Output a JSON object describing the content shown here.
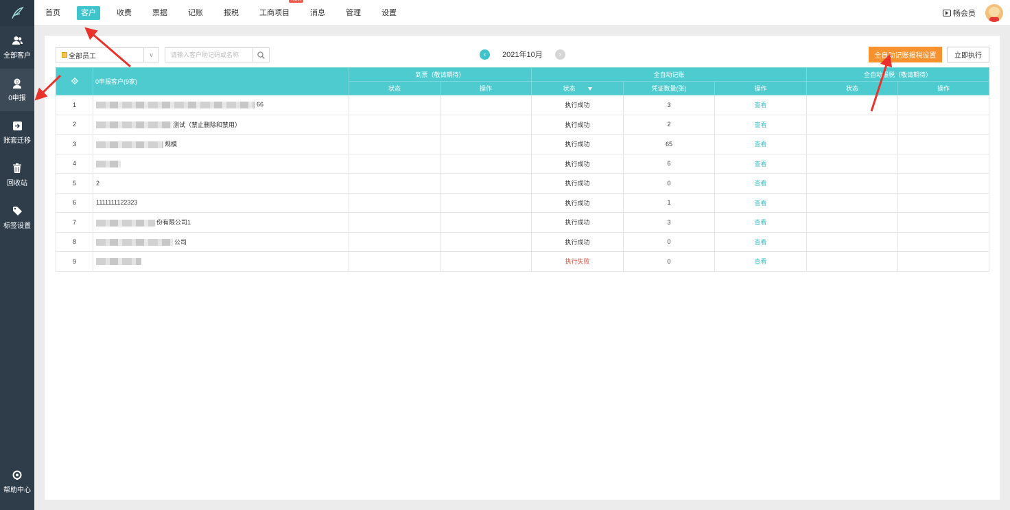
{
  "sidebar": {
    "items": [
      {
        "label": "全部客户",
        "icon": "users-icon"
      },
      {
        "label": "0申报",
        "icon": "zero-report-icon"
      },
      {
        "label": "账套迁移",
        "icon": "migrate-icon"
      },
      {
        "label": "回收站",
        "icon": "trash-icon"
      },
      {
        "label": "标签设置",
        "icon": "tag-icon"
      }
    ],
    "help": "帮助中心"
  },
  "nav": {
    "items": [
      "首页",
      "客户",
      "收费",
      "票据",
      "记账",
      "报税",
      "工商项目",
      "消息",
      "管理",
      "设置"
    ],
    "active": "客户",
    "new_badge": "new",
    "member": "畅会员"
  },
  "toolbar": {
    "staff_select": "全部员工",
    "search_placeholder": "请输入客户助记码或名称",
    "month": "2021年10月",
    "auto_setting_button": "全自动记账报税设置",
    "run_now_button": "立即执行"
  },
  "table": {
    "name_header": "0申报客户(9家)",
    "group_headers": [
      "到票（敬请期待）",
      "全自动记账",
      "全自动报税（敬请期待）"
    ],
    "sub_headers": [
      "状态",
      "操作",
      "状态",
      "凭证数量(张)",
      "操作",
      "状态",
      "操作"
    ],
    "rows": [
      {
        "no": "1",
        "name_suffix": "66",
        "status": "执行成功",
        "count": "3",
        "action": "查看"
      },
      {
        "no": "2",
        "name_suffix": "测试（禁止删除和禁用）",
        "status": "执行成功",
        "count": "2",
        "action": "查看"
      },
      {
        "no": "3",
        "name_suffix": "规模",
        "status": "执行成功",
        "count": "65",
        "action": "查看"
      },
      {
        "no": "4",
        "name_suffix": "",
        "status": "执行成功",
        "count": "6",
        "action": "查看"
      },
      {
        "no": "5",
        "name_suffix": "2",
        "status": "执行成功",
        "count": "0",
        "action": "查看"
      },
      {
        "no": "6",
        "name_suffix": "1111111122323",
        "status": "执行成功",
        "count": "1",
        "action": "查看"
      },
      {
        "no": "7",
        "name_suffix": "份有限公司1",
        "status": "执行成功",
        "count": "3",
        "action": "查看"
      },
      {
        "no": "8",
        "name_suffix": "公司",
        "status": "执行成功",
        "count": "0",
        "action": "查看"
      },
      {
        "no": "9",
        "name_suffix": "",
        "status": "执行失败",
        "count": "0",
        "action": "查看"
      }
    ]
  },
  "colors": {
    "accent": "#4ecbcf",
    "orange": "#f7922e",
    "fail": "#e24b3b",
    "rail": "#2f3d4b",
    "annotation": "#e8322b"
  }
}
